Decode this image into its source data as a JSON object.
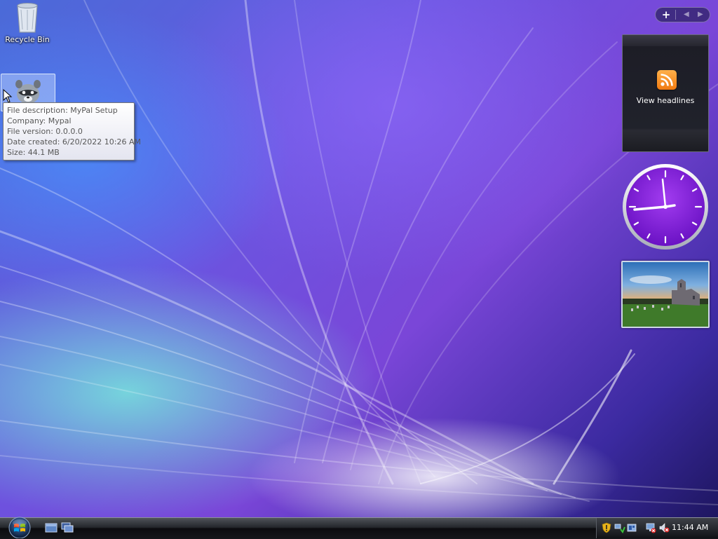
{
  "desktop": {
    "icons": [
      {
        "label": "Recycle Bin",
        "icon": "recycle-bin-icon"
      },
      {
        "label": "",
        "icon": "raccoon-mypal-icon"
      }
    ],
    "tooltip": {
      "lines": [
        "File description: MyPal Setup",
        "Company: Mypal",
        "File version: 0.0.0.0",
        "Date created: 6/20/2022 10:26 AM",
        "Size: 44.1 MB"
      ]
    }
  },
  "sidebar": {
    "add_label": "+",
    "prev_label": "◀",
    "next_label": "▶",
    "feed_gadget": {
      "label": "View headlines",
      "icon": "rss-feed-icon"
    },
    "clock_gadget": {
      "icon": "analog-clock-icon"
    },
    "slideshow_gadget": {
      "icon": "slideshow-photo"
    }
  },
  "taskbar": {
    "start_icon": "windows-start-orb",
    "quick_launch": [
      "show-desktop-icon",
      "switch-windows-icon"
    ],
    "tray_icons": [
      "security-alert-icon",
      "network-icon",
      "safely-remove-icon",
      "network-disconnected-icon",
      "volume-muted-icon"
    ],
    "clock": "11:44 AM"
  },
  "colors": {
    "accent": "#7a46d8",
    "feed_orange": "#f07a10",
    "clock_face": "#8a2be2"
  }
}
